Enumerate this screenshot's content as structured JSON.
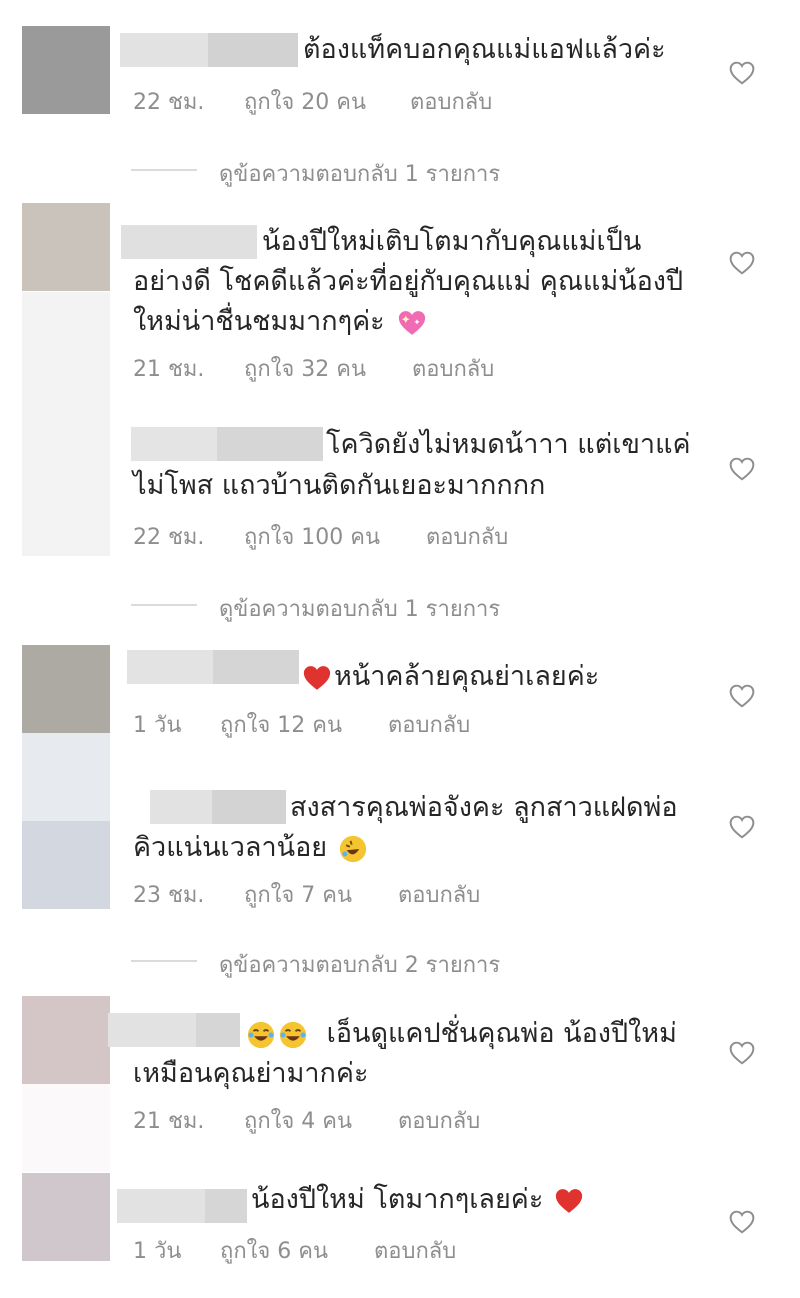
{
  "comments": [
    {
      "lines": [
        "ต้องแท็คบอกคุณแม่แอฟแล้วค่ะ"
      ],
      "time": "22 ชม.",
      "likes": "ถูกใจ 20 คน",
      "reply": "ตอบกลับ",
      "avatar_color": "#9a9a9a"
    },
    {
      "lines": [
        "น้องปีใหม่เติบโตมากับคุณแม่เป็น",
        "อย่างดี โชคดีแล้วค่ะที่อยู่กับคุณแม่ คุณแม่น้องปี",
        "ใหม่น่าชื่นชมมากๆค่ะ"
      ],
      "emoji": "sparkling-heart",
      "time": "21 ชม.",
      "likes": "ถูกใจ 32 คน",
      "reply": "ตอบกลับ",
      "avatar_color": "#c9c3bc"
    },
    {
      "lines": [
        "โควิดยังไม่หมดน้าาา แต่เขาแค่",
        "ไม่โพส แถวบ้านติดกันเยอะมากกกก"
      ],
      "time": "22 ชม.",
      "likes": "ถูกใจ 100 คน",
      "reply": "ตอบกลับ",
      "avatar_color": "#f3f3f4"
    },
    {
      "lines": [
        "หน้าคล้ายคุณย่าเลยค่ะ"
      ],
      "emoji": "red-heart",
      "time": "1 วัน",
      "likes": "ถูกใจ 12 คน",
      "reply": "ตอบกลับ",
      "avatar_color": "#adaaa4"
    },
    {
      "lines": [
        "สงสารคุณพ่อจังคะ ลูกสาวแฝดพ่อ",
        "คิวแน่นเวลาน้อย"
      ],
      "emoji": "rofl",
      "time": "23 ชม.",
      "likes": "ถูกใจ 7 คน",
      "reply": "ตอบกลับ",
      "avatar_color": "#d3d7df"
    },
    {
      "lines": [
        "เอ็นดูแคปชั่นคุณพ่อ น้องปีใหม่",
        "เหมือนคุณย่ามากค่ะ"
      ],
      "emoji": "joy",
      "time": "21 ชม.",
      "likes": "ถูกใจ 4 คน",
      "reply": "ตอบกลับ",
      "avatar_color": "#d4c6c6"
    },
    {
      "lines": [
        "น้องปีใหม่ โตมากๆเลยค่ะ"
      ],
      "emoji": "red-heart",
      "time": "1 วัน",
      "likes": "ถูกใจ 6 คน",
      "reply": "ตอบกลับ",
      "avatar_color": "#d0c7cc"
    }
  ],
  "view_replies": [
    "ดูข้อความตอบกลับ 1 รายการ",
    "ดูข้อความตอบกลับ 1 รายการ",
    "ดูข้อความตอบกลับ 2 รายการ"
  ],
  "like_icon": "heart-outline-icon",
  "colors": {
    "text": "#262626",
    "secondary": "#8e8e8e",
    "blur": "#dcdcdc",
    "divider": "#dbdbdb"
  }
}
